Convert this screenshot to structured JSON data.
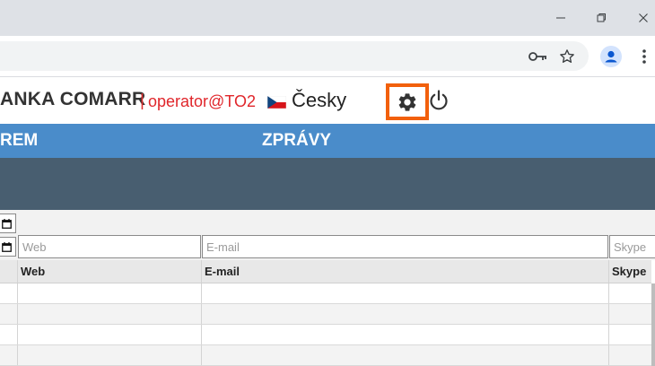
{
  "browser": {
    "icons": [
      "minimize-icon",
      "maximize-icon",
      "close-icon",
      "key-icon",
      "star-icon",
      "profile-icon",
      "menu-icon"
    ]
  },
  "header": {
    "brand": "ANKA COMARR",
    "separator": "|",
    "operator": "operator@TO2",
    "language": "Česky"
  },
  "nav": {
    "items": [
      "REM",
      "ZPRÁVY"
    ]
  },
  "filters": {
    "web_placeholder": "Web",
    "email_placeholder": "E-mail",
    "skype_placeholder": "Skype"
  },
  "table": {
    "columns": [
      "",
      "Web",
      "E-mail",
      "Skype"
    ],
    "rows": [
      [
        "",
        "",
        "",
        ""
      ],
      [
        "",
        "",
        "",
        ""
      ],
      [
        "",
        "",
        "",
        ""
      ],
      [
        "",
        "",
        "",
        ""
      ]
    ]
  },
  "colors": {
    "accent_nav": "#4a8cca",
    "dark_band": "#485e70",
    "operator_red": "#e0262b",
    "highlight_orange": "#f2600c"
  }
}
